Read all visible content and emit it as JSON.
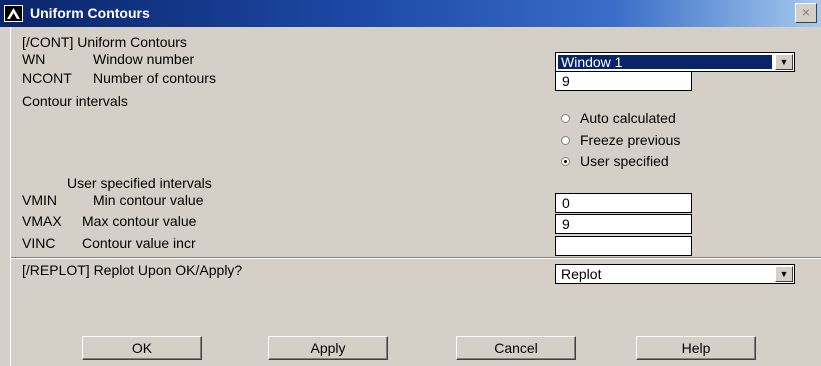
{
  "window": {
    "title": "Uniform Contours",
    "close": "×"
  },
  "header": {
    "command": "[/CONT] Uniform Contours"
  },
  "rows": {
    "wn": {
      "key": "WN",
      "desc": "Window number"
    },
    "ncont": {
      "key": "NCONT",
      "desc": "Number of contours"
    },
    "intervals": {
      "label": "Contour intervals"
    },
    "user_intervals": {
      "label": "User specified intervals"
    },
    "vmin": {
      "key": "VMIN",
      "desc": "Min contour value"
    },
    "vmax": {
      "key": "VMAX",
      "desc": "Max contour value"
    },
    "vinc": {
      "key": "VINC",
      "desc": "Contour value incr"
    },
    "replot": {
      "label": "[/REPLOT] Replot Upon OK/Apply?"
    }
  },
  "fields": {
    "window_select": "Window 1",
    "ncont_value": "9",
    "vmin_value": "0",
    "vmax_value": "9",
    "vinc_value": "",
    "replot_select": "Replot",
    "dropdown_arrow": "▼"
  },
  "radio": {
    "auto": "Auto calculated",
    "freeze": "Freeze previous",
    "user": "User specified",
    "selected": "user"
  },
  "buttons": {
    "ok": "OK",
    "apply": "Apply",
    "cancel": "Cancel",
    "help": "Help"
  },
  "colors": {
    "title_start": "#0a246a",
    "title_end": "#a6caf0",
    "dialog_bg": "#d4d0c8",
    "selection": "#0a246a"
  }
}
